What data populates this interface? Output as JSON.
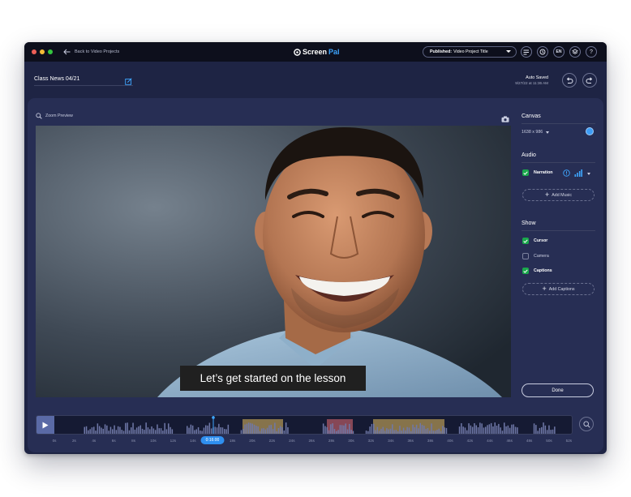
{
  "titlebar": {
    "back_label": "Back to Video Projects",
    "logo_screen": "Screen",
    "logo_pal": "Pal",
    "publish_bold": "Published:",
    "publish_label": "Video Project Title",
    "language": "EN",
    "help": "?"
  },
  "header": {
    "project_title": "Class News 04/21",
    "autosave_status": "Auto Saved",
    "autosave_time": "9/27/22 at 11:36 AM"
  },
  "preview": {
    "zoom_label": "Zoom Preview",
    "caption": "Let’s get started on the lesson"
  },
  "sidebar": {
    "canvas_title": "Canvas",
    "canvas_size": "1638 x 986",
    "canvas_color": "#3d9cf5",
    "audio_title": "Audio",
    "narration_label": "Narration",
    "add_music_label": "Add Music",
    "show_title": "Show",
    "cursor_label": "Cursor",
    "camera_label": "Camera",
    "captions_label": "Captions",
    "add_captions_label": "Add Captions",
    "done_label": "Done"
  },
  "timeline": {
    "current_time": "0:16:00",
    "ticks": [
      "0s",
      "2s",
      "4s",
      "6s",
      "8s",
      "10s",
      "12s",
      "14s",
      "16s",
      "18s",
      "20s",
      "22s",
      "24s",
      "26s",
      "28s",
      "30s",
      "32s",
      "34s",
      "36s",
      "38s",
      "40s",
      "42s",
      "44s",
      "46s",
      "48s",
      "50s",
      "52s"
    ]
  },
  "colors": {
    "accent": "#3d9cf5",
    "check": "#1aa84c",
    "segment_gold": "#b69a55",
    "segment_red": "#a3525f",
    "window_bg": "#1e2444",
    "panel_bg": "#272e54"
  },
  "icons": {
    "back": "arrow-left-icon",
    "logo": "screenpal-logo-icon",
    "edit": "edit-icon",
    "undo": "undo-icon",
    "redo": "redo-icon",
    "zoom": "search-icon",
    "snapshot": "camera-icon",
    "info": "info-icon",
    "volume": "volume-bars-icon",
    "play": "play-icon"
  }
}
